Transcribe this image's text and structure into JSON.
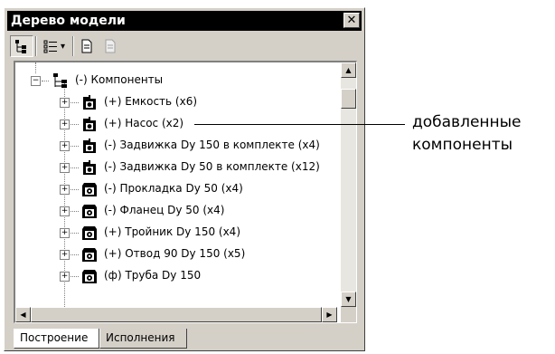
{
  "window": {
    "title": "Дерево модели",
    "close_glyph": "✕"
  },
  "toolbar": {
    "buttons": [
      {
        "name": "tree-structure-icon"
      },
      {
        "name": "list-view-icon",
        "has_dropdown": true
      },
      {
        "name": "document-icon"
      },
      {
        "name": "document-disabled-icon"
      }
    ],
    "dropdown_glyph": "▾"
  },
  "tree": {
    "root": {
      "label": "(-) Компоненты",
      "expander": "−"
    },
    "items": [
      {
        "label": "(+) Емкость (х6)",
        "expander": "+",
        "icon": "part-icon"
      },
      {
        "label": "(+) Насос (х2)",
        "expander": "+",
        "icon": "part-icon"
      },
      {
        "label": "(-) Задвижка Dy 150 в комплекте (х4)",
        "expander": "+",
        "icon": "part-icon"
      },
      {
        "label": "(-) Задвижка Dy 50 в комплекте (х12)",
        "expander": "+",
        "icon": "part-icon"
      },
      {
        "label": "(-) Прокладка Dy 50 (х4)",
        "expander": "+",
        "icon": "detail-icon"
      },
      {
        "label": "(-) Фланец Dy 50 (х4)",
        "expander": "+",
        "icon": "detail-icon"
      },
      {
        "label": "(+) Тройник Dy 150 (х4)",
        "expander": "+",
        "icon": "detail-icon"
      },
      {
        "label": "(+) Отвод 90 Dy 150 (х5)",
        "expander": "+",
        "icon": "detail-icon"
      },
      {
        "label": "(ф) Труба Dy 150",
        "expander": "+",
        "icon": "detail-icon"
      }
    ]
  },
  "scrollbars": {
    "up": "▲",
    "down": "▼",
    "left": "◀",
    "right": "▶"
  },
  "tabs": [
    {
      "label": "Построение",
      "active": true
    },
    {
      "label": "Исполнения",
      "active": false
    }
  ],
  "annotation": {
    "line1": "добавленные",
    "line2": "компоненты"
  }
}
